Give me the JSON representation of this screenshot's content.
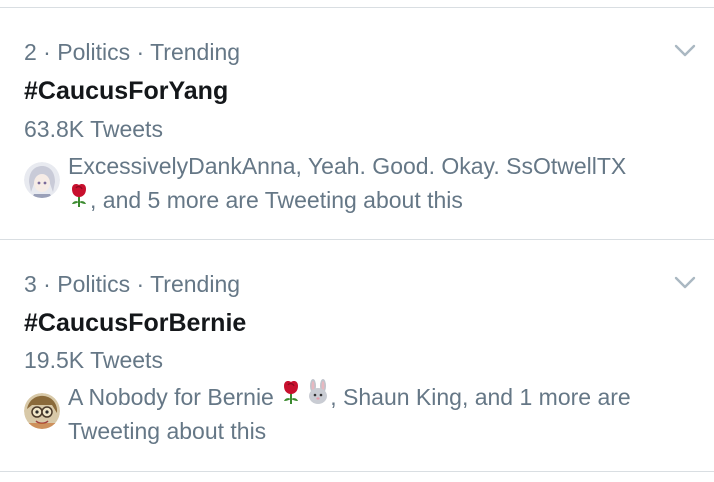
{
  "trends": [
    {
      "meta": "2 · Politics · Trending",
      "hashtag": "#CaucusForYang",
      "tweet_count": "63.8K Tweets",
      "context_line1": "ExcessivelyDankAnna, Yeah. Good. Okay. SsOtwellTX",
      "context_line2": ", and 5 more are Tweeting about this",
      "avatar_icon": "anime-avatar",
      "emoji_icons": [
        "rose-emoji"
      ]
    },
    {
      "meta": "3 · Politics · Trending",
      "hashtag": "#CaucusForBernie",
      "tweet_count": "19.5K Tweets",
      "context_name": "A Nobody for Bernie",
      "context_line1_rest": ", Shaun King, and 1 more are",
      "context_line2": "Tweeting about this",
      "avatar_icon": "cartoon-avatar",
      "emoji_icons": [
        "rose-emoji",
        "rabbit-emoji"
      ]
    }
  ],
  "colors": {
    "secondary_text": "#657786",
    "primary_text": "#14171a",
    "divider": "#d9dee2",
    "chevron": "#aab8c2"
  }
}
